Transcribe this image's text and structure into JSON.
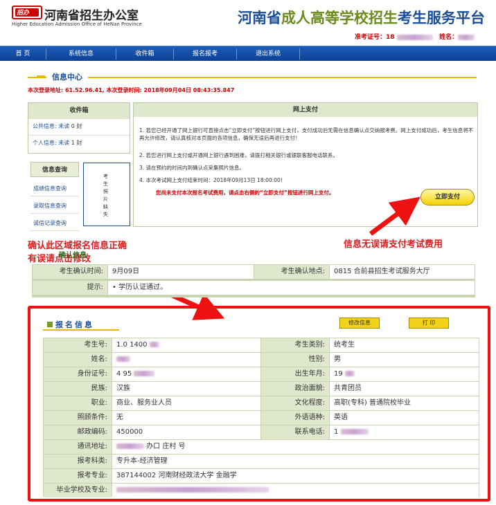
{
  "header": {
    "logo_text": "招办",
    "office_title": "河南省招生办公室",
    "office_en": "Higher Education Admission Office of HeNan Province",
    "platform_title_a": "河南省",
    "platform_title_b": "成人高等学校招生",
    "platform_title_c": "考生服务平台",
    "exam_no_label": "准考证号：",
    "exam_no_value": "18",
    "name_label": "姓名："
  },
  "nav": {
    "items": [
      "首 页",
      "系统信息",
      "收件箱",
      "报名报考",
      "退出系统"
    ]
  },
  "info_center": {
    "title": "信息中心",
    "login_line": "本次登录地址: 61.52.96.41, 本次登录时间: 2018年09月04日 08:43:35.847"
  },
  "inbox": {
    "title": "收件箱",
    "public_label": "公共信息: 未读",
    "public_count": "0 封",
    "personal_label": "个人信息: 未读",
    "personal_count": "1 封"
  },
  "query": {
    "title": "信息查询",
    "items": [
      "成绩信息查询",
      "录取信息查询",
      "诚信记录查询"
    ]
  },
  "photo": {
    "text": "考生照片缺失"
  },
  "payment": {
    "title": "网上支付",
    "items": [
      "1. 若您已经开通了网上银行可直接点击“立即支付”按钮进行网上支付，支付成功后无需在信息确认点交纳报考费。网上支付成功后，考生信息将不再允许修改，请认真核对本页面的各项信息，确保无误后再进行支付！",
      "2. 若您进行网上支付或开通网上银行遇到困难，请拨打相关银行或银联客服电话联系。",
      "3. 请在预约的时间内到确认点采集照片信息。",
      "4. 本次考试网上支付结束时间：2018年09月13日 18:00:00！"
    ],
    "note": "您尚未支付本次报名考试费用，请点击右侧的“立即支付”按钮进行网上支付。",
    "pay_button": "立即支付"
  },
  "annotations": {
    "left_line1": "确认此区域报名信息正确",
    "left_line2": "有误请点击修改",
    "right": "信息无误请支付考试费用"
  },
  "confirm": {
    "title": "确认信息",
    "time_label": "考生确认时间:",
    "time_value": "9月09日",
    "place_label": "考生确认地点:",
    "place_value": "0815  合前县招生考试服务大厅",
    "tip_label": "提示:",
    "tip_value": "• 学历认证通过。"
  },
  "registration": {
    "title": "报名信息",
    "edit_button": "修改信息",
    "print_button": "打  印",
    "rows": [
      {
        "l1": "考生号:",
        "v1": "1.0  1400",
        "l2": "考生类别:",
        "v2": "统考生"
      },
      {
        "l1": "姓名:",
        "v1": "",
        "l2": "性别:",
        "v2": "男"
      },
      {
        "l1": "身份证号:",
        "v1": "4  95",
        "l2": "出生年月:",
        "v2": "19"
      },
      {
        "l1": "民族:",
        "v1": "汉族",
        "l2": "政治面貌:",
        "v2": "共青团员"
      },
      {
        "l1": "职业:",
        "v1": "商业、服务业人员",
        "l2": "文化程度:",
        "v2": "高职(专科) 普通院校毕业"
      },
      {
        "l1": "照顾条件:",
        "v1": "无",
        "l2": "外语语种:",
        "v2": "英语"
      },
      {
        "l1": "邮政编码:",
        "v1": "450000",
        "l2": "联系电话:",
        "v2": "1"
      }
    ],
    "wide_rows": [
      {
        "label": "通讯地址:",
        "value": "办口  庄村  号"
      },
      {
        "label": "报考科类:",
        "value": "专升本-经济管理"
      },
      {
        "label": "报考专业:",
        "value": "387144002  河南财经政法大学  金融学"
      },
      {
        "label": "毕业学校及专业:",
        "value": ""
      }
    ]
  }
}
